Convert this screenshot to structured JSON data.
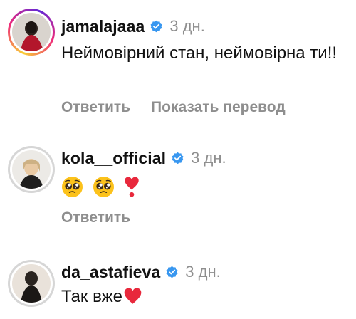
{
  "comments": [
    {
      "username": "jamalajaaa",
      "time": "3 дн.",
      "text": "Неймовірний стан, неймовірна ти!!",
      "reply_label": "Ответить",
      "translate_label": "Показать перевод"
    },
    {
      "username": "kola__official",
      "time": "3 дн.",
      "text": "",
      "emojis": [
        "pleading-face",
        "pleading-face",
        "heart-exclamation"
      ],
      "reply_label": "Ответить"
    },
    {
      "username": "da_astafieva",
      "time": "3 дн.",
      "text": "Так вже",
      "emojis": [
        "red-heart"
      ]
    }
  ],
  "colors": {
    "verified_badge": "#3897f0",
    "meta_grey": "#8e8e8e",
    "heart_red": "#e8283c"
  }
}
